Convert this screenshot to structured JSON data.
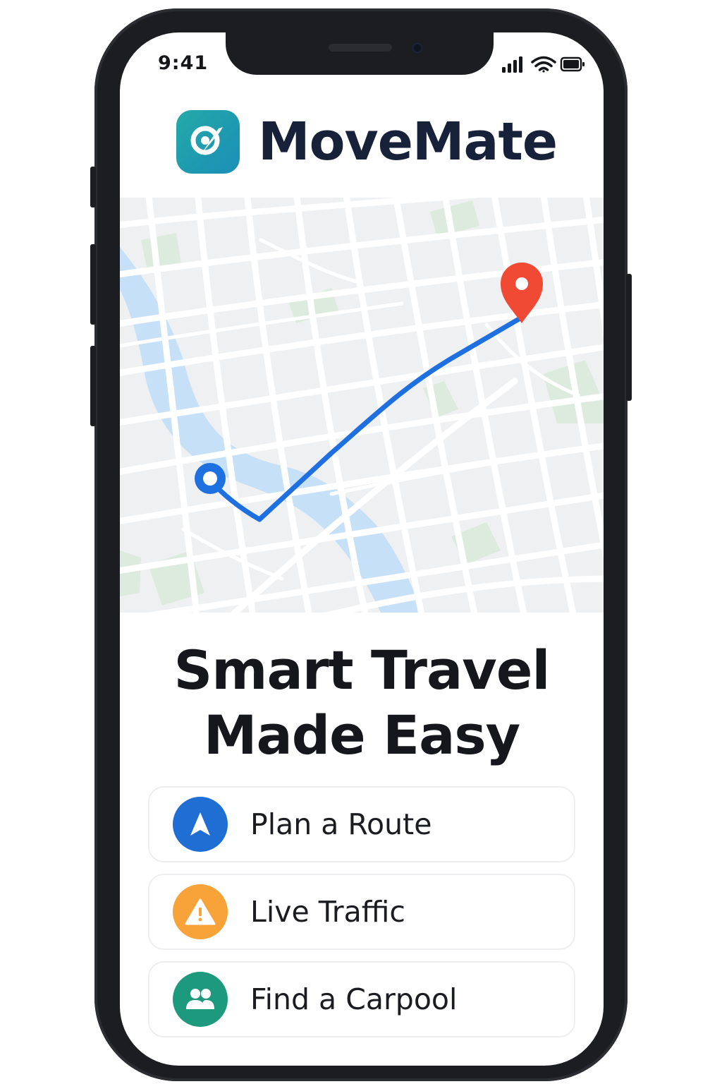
{
  "status_bar": {
    "time": "9:41",
    "icons": [
      "signal-icon",
      "wifi-icon",
      "battery-icon"
    ]
  },
  "brand": {
    "name": "MoveMate",
    "logo_icon": "location-arrow-icon",
    "logo_color": "#1f9fb0"
  },
  "map": {
    "start_marker_icon": "origin-marker-icon",
    "end_marker_icon": "destination-pin-icon",
    "route_color": "#1e6fe0",
    "pin_color": "#f04a35",
    "water_color": "#c6e1f7",
    "park_color": "#dcebdd"
  },
  "headline": {
    "line1": "Smart Travel",
    "line2": "Made Easy"
  },
  "actions": [
    {
      "label": "Plan a Route",
      "icon": "navigation-arrow-icon",
      "color": "#1f6ed4"
    },
    {
      "label": "Live Traffic",
      "icon": "warning-icon",
      "color": "#f8a23a"
    },
    {
      "label": "Find a Carpool",
      "icon": "people-icon",
      "color": "#1d9a7d"
    }
  ]
}
